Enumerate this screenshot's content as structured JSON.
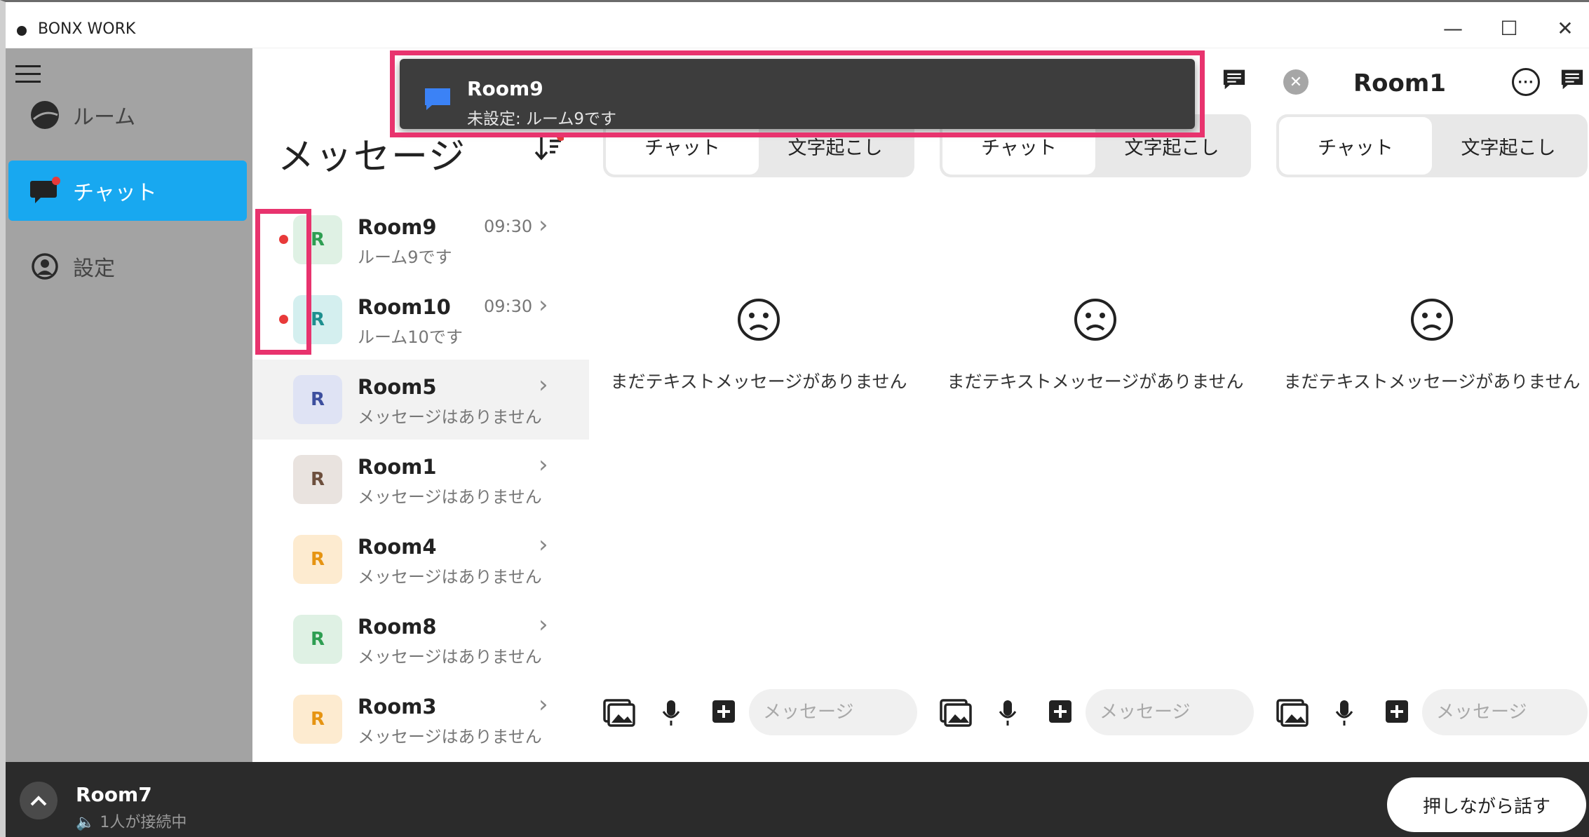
{
  "app": {
    "title": "BONX WORK",
    "window_controls": {
      "minimize": "—",
      "maximize": "☐",
      "close": "✕"
    }
  },
  "sidebar": {
    "items": [
      {
        "label": "ルーム",
        "icon": "room-icon",
        "active": false
      },
      {
        "label": "チャット",
        "icon": "chat-bubble-icon",
        "active": true
      },
      {
        "label": "設定",
        "icon": "user-circle-icon",
        "active": false
      }
    ]
  },
  "list": {
    "title": "メッセージ",
    "rooms": [
      {
        "avatar": "R",
        "name": "Room9",
        "preview": "ルーム9です",
        "time": "09:30",
        "unread": true,
        "avatar_bg": "#dff1e4",
        "avatar_fg": "#2e9e52"
      },
      {
        "avatar": "R",
        "name": "Room10",
        "preview": "ルーム10です",
        "time": "09:30",
        "unread": true,
        "avatar_bg": "#d4efef",
        "avatar_fg": "#1e8f8f"
      },
      {
        "avatar": "R",
        "name": "Room5",
        "preview": "メッセージはありません",
        "time": "",
        "unread": false,
        "avatar_bg": "#dfe3f4",
        "avatar_fg": "#3d4f9e"
      },
      {
        "avatar": "R",
        "name": "Room1",
        "preview": "メッセージはありません",
        "time": "",
        "unread": false,
        "avatar_bg": "#e9e3df",
        "avatar_fg": "#6d4f3d"
      },
      {
        "avatar": "R",
        "name": "Room4",
        "preview": "メッセージはありません",
        "time": "",
        "unread": false,
        "avatar_bg": "#fdebd0",
        "avatar_fg": "#e69412"
      },
      {
        "avatar": "R",
        "name": "Room8",
        "preview": "メッセージはありません",
        "time": "",
        "unread": false,
        "avatar_bg": "#dff1e4",
        "avatar_fg": "#2e9e52"
      },
      {
        "avatar": "R",
        "name": "Room3",
        "preview": "メッセージはありません",
        "time": "",
        "unread": false,
        "avatar_bg": "#fdebd0",
        "avatar_fg": "#e69412"
      }
    ]
  },
  "columns": [
    {
      "title": "",
      "tab_chat": "チャット",
      "tab_transcript": "文字起こし",
      "empty": "まだテキストメッセージがありません",
      "placeholder": "メッセージ"
    },
    {
      "title": "",
      "tab_chat": "チャット",
      "tab_transcript": "文字起こし",
      "empty": "まだテキストメッセージがありません",
      "placeholder": "メッセージ"
    },
    {
      "title": "Room1",
      "tab_chat": "チャット",
      "tab_transcript": "文字起こし",
      "empty": "まだテキストメッセージがありません",
      "placeholder": "メッセージ"
    }
  ],
  "notification": {
    "title": "Room9",
    "body": "未設定: ルーム9です"
  },
  "bottom_bar": {
    "room": "Room7",
    "status": "1人が接続中",
    "ptt_label": "押しながら話す"
  },
  "colors": {
    "accent": "#18a8f0",
    "sidebar_bg": "#a3a3a3",
    "highlight": "#e8336e",
    "unread": "#e83a3a"
  }
}
